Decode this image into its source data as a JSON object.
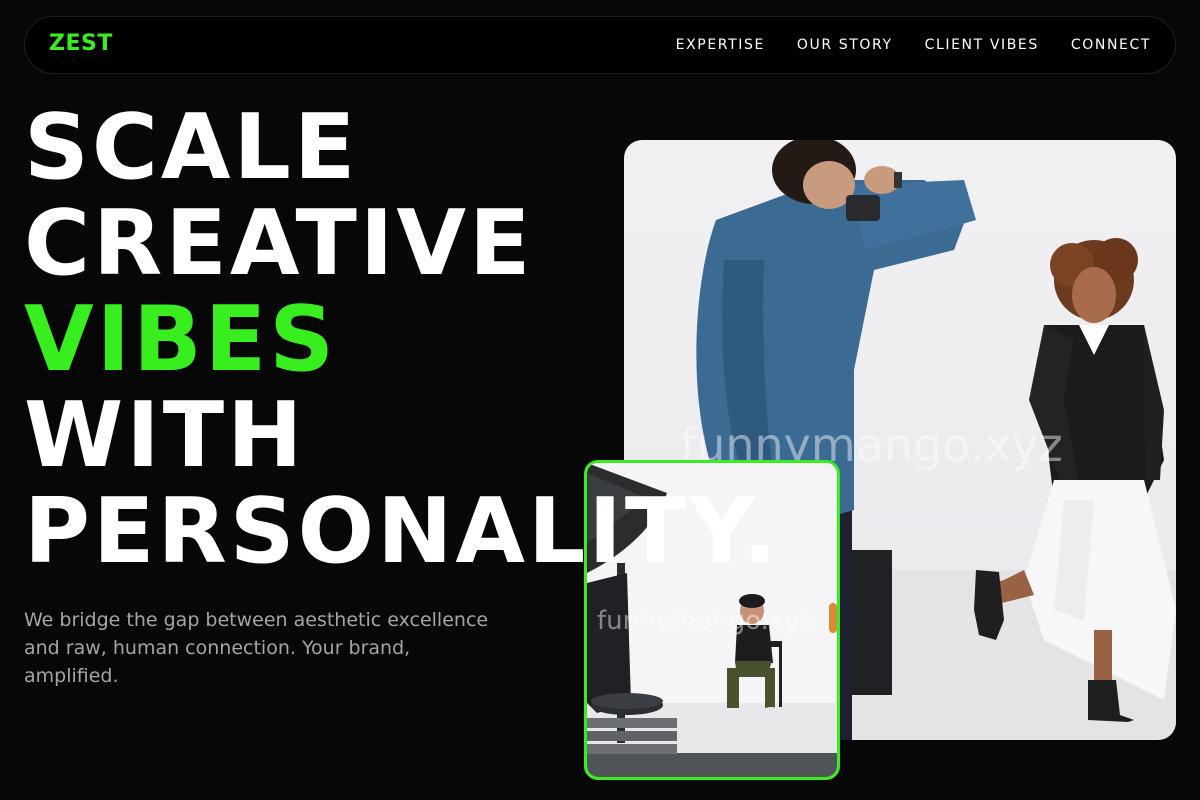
{
  "brand": {
    "logo": "ZEST",
    "accent_color": "#39ee1f"
  },
  "nav": {
    "items": [
      {
        "label": "EXPERTISE"
      },
      {
        "label": "OUR STORY"
      },
      {
        "label": "CLIENT VIBES"
      },
      {
        "label": "CONNECT"
      }
    ]
  },
  "hero": {
    "headline_lines": [
      "SCALE",
      "CREATIVE",
      "VIBES",
      "WITH",
      "PERSONALITY."
    ],
    "highlight_line": "VIBES",
    "subcopy": "We bridge the gap between aesthetic excellence and raw, human connection. Your brand, amplified."
  },
  "media": {
    "main_image": "photographer-shooting-model-photo",
    "secondary_image": "studio-model-seated-photo",
    "watermark": "funnymango.xyz"
  }
}
